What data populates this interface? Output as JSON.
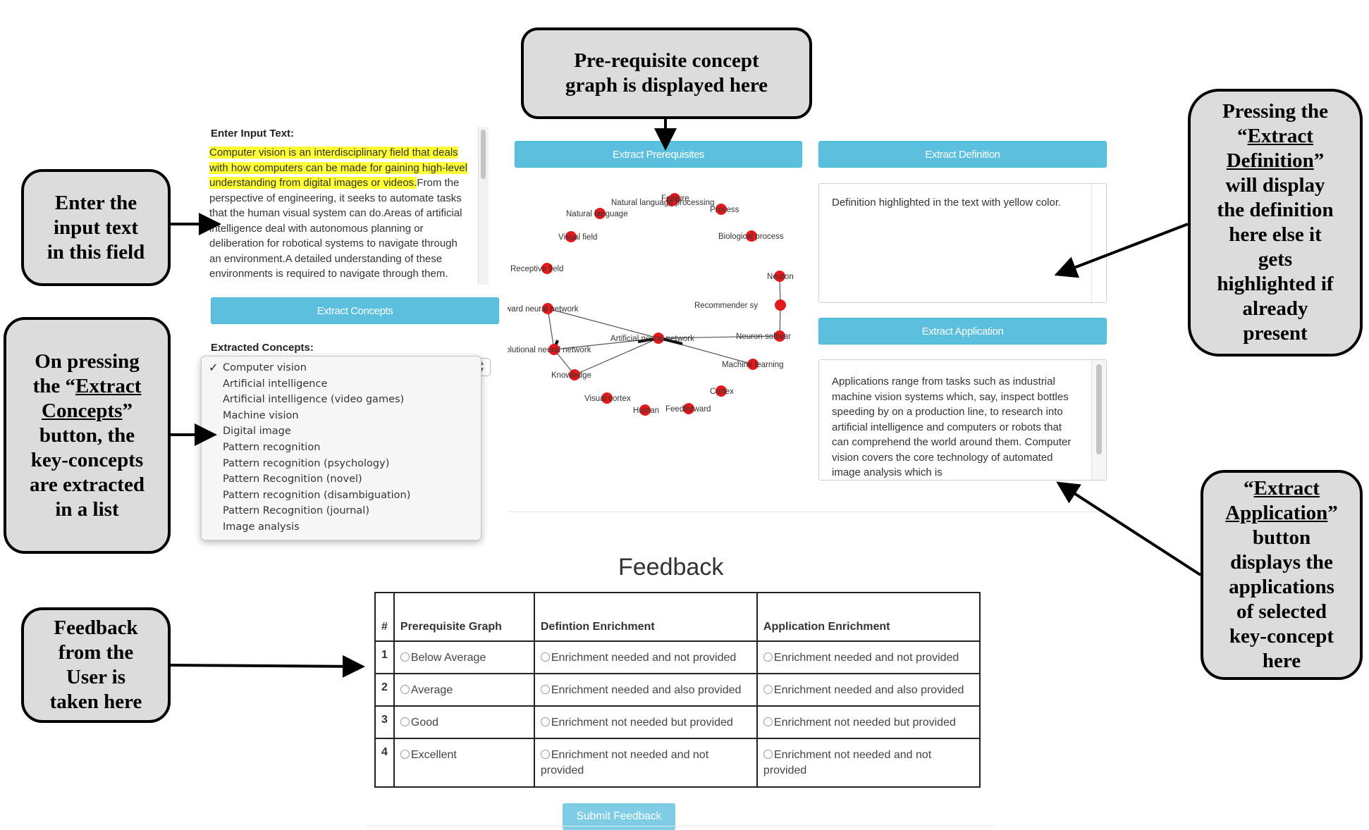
{
  "callouts": {
    "prereq": [
      "Pre-requisite concept",
      "graph is displayed here"
    ],
    "enter_input": [
      "Enter the",
      "input text",
      "in this field"
    ],
    "extract_concepts": {
      "l1": "On pressing",
      "l2a": "the “",
      "l2u": "Extract",
      "l3u": "Concepts",
      "l3b": "”",
      "l4": "button, the",
      "l5": "key-concepts",
      "l6": "are extracted",
      "l7": "in a list"
    },
    "feedback": [
      "Feedback",
      "from the",
      "User is",
      "taken here"
    ],
    "definition": {
      "l1": "Pressing the",
      "l2a": "“",
      "l2u": "Extract",
      "l3u": "Definition",
      "l3b": "”",
      "l4": "will display",
      "l5": "the definition",
      "l6": "here else it",
      "l7": "gets",
      "l8": "highlighted if",
      "l9": "already",
      "l10": "present"
    },
    "application": {
      "l1a": "“",
      "l1u": "Extract",
      "l2u": "Application",
      "l2b": "”",
      "l3": "button",
      "l4": "displays the",
      "l5": "applications",
      "l6": "of selected",
      "l7": "key-concept",
      "l8": "here"
    }
  },
  "input": {
    "label": "Enter Input Text:",
    "highlighted_text": "Computer vision is an interdisciplinary field that deals with how computers can be made for gaining high-level understanding from digital images or videos.",
    "rest_text": "From the perspective of engineering, it seeks to automate tasks that the human visual system can do.Areas of artificial intelligence deal with autonomous planning or deliberation for robotical systems to navigate through an environment.A detailed understanding of these environments is required to navigate through them. Information about"
  },
  "buttons": {
    "extract_concepts": "Extract Concepts",
    "extract_prerequisites": "Extract Prerequisites",
    "extract_definition": "Extract Definition",
    "extract_application": "Extract Application",
    "submit_feedback": "Submit Feedback"
  },
  "concepts": {
    "label": "Extracted Concepts:",
    "selected": "Computer vision",
    "options": [
      "Computer vision",
      "Artificial intelligence",
      "Artificial intelligence (video games)",
      "Machine vision",
      "Digital image",
      "Pattern recognition",
      "Pattern recognition (psychology)",
      "Pattern Recognition (novel)",
      "Pattern recognition (disambiguation)",
      "Pattern Recognition (journal)",
      "Image analysis"
    ]
  },
  "graph": {
    "node_color": "#e31a1c",
    "nodes": [
      "Natural language processing",
      "Feature",
      "Natural language",
      "Process",
      "Visual field",
      "Biological process",
      "Receptive field",
      "Neuron",
      "Recommender sy",
      "ward neural network",
      "Artificial neural network",
      "Neuron softwar",
      "olutional neural network",
      "Machine learning",
      "Knowledge",
      "Cortex",
      "Visual cortex",
      "Human",
      "Feedforward"
    ]
  },
  "definition": {
    "text": "Definition highlighted in the text with yellow color."
  },
  "application": {
    "text": "Applications range from tasks such as industrial machine vision systems which, say, inspect bottles speeding by on a production line, to research into artificial intelligence and computers or robots that can comprehend the world around them. Computer vision covers the core technology of automated image analysis which is"
  },
  "feedback": {
    "title": "Feedback",
    "headers": [
      "#",
      "Prerequisite Graph",
      "Defintion Enrichment",
      "Application Enrichment"
    ],
    "rows": [
      {
        "num": "1",
        "graph": "Below Average",
        "definition": "Enrichment needed and not provided",
        "application": "Enrichment needed and not provided"
      },
      {
        "num": "2",
        "graph": "Average",
        "definition": "Enrichment needed and also provided",
        "application": "Enrichment needed and also provided"
      },
      {
        "num": "3",
        "graph": "Good",
        "definition": "Enrichment not needed but provided",
        "application": "Enrichment not needed but provided"
      },
      {
        "num": "4",
        "graph": "Excellent",
        "definition": "Enrichment not needed and not provided",
        "application": "Enrichment not needed and not provided"
      }
    ]
  }
}
